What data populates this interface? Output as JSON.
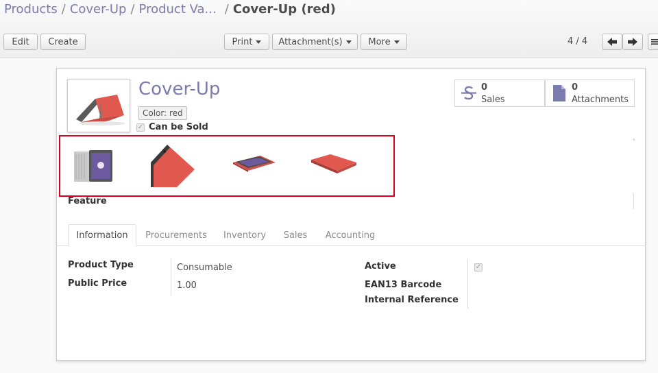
{
  "breadcrumb": {
    "items": [
      "Products",
      "Cover-Up",
      "Product Va..."
    ],
    "separator": "/",
    "current": "Cover-Up (red)"
  },
  "toolbar": {
    "edit_label": "Edit",
    "create_label": "Create",
    "print_label": "Print",
    "attachments_label": "Attachment(s)",
    "more_label": "More"
  },
  "pager": {
    "value": "4 / 4"
  },
  "product": {
    "name": "Cover-Up",
    "variant_tag": "Color: red",
    "can_be_sold_label": "Can be Sold",
    "can_be_sold": true,
    "feature_label": "Feature"
  },
  "stats": {
    "sales_count": "0",
    "sales_label": "Sales",
    "attachments_count": "0",
    "attachments_label": "Attachments"
  },
  "tabs": [
    "Information",
    "Procurements",
    "Inventory",
    "Sales",
    "Accounting"
  ],
  "info": {
    "product_type_label": "Product Type",
    "product_type_value": "Consumable",
    "public_price_label": "Public Price",
    "public_price_value": "1.00",
    "active_label": "Active",
    "active": true,
    "ean13_label": "EAN13 Barcode",
    "internal_ref_label": "Internal Reference"
  },
  "colors": {
    "brand": "#7c7bad",
    "highlight_border": "#d9001b",
    "product_red": "#e0584e"
  }
}
